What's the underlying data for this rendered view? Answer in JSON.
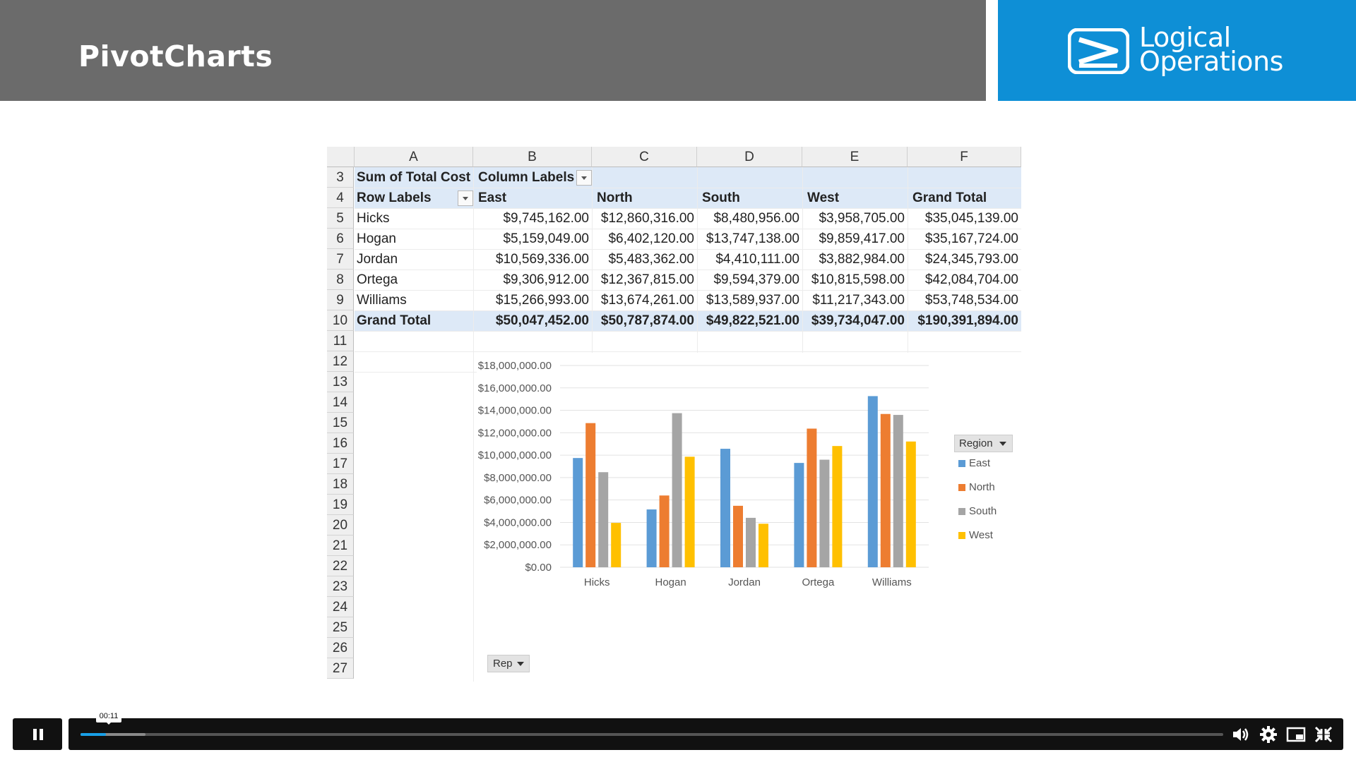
{
  "slide": {
    "title": "PivotCharts"
  },
  "logo": {
    "line1": "Logical",
    "line2": "Operations",
    "colors": {
      "background": "#0e8fd6",
      "title_bar": "#6b6b6b"
    }
  },
  "sheet": {
    "columns": [
      "A",
      "B",
      "C",
      "D",
      "E",
      "F"
    ],
    "row_numbers": [
      "3",
      "4",
      "5",
      "6",
      "7",
      "8",
      "9",
      "10",
      "11",
      "12",
      "13",
      "14",
      "15",
      "16",
      "17",
      "18",
      "19",
      "20",
      "21",
      "22",
      "23",
      "24",
      "25",
      "26",
      "27"
    ],
    "r3": {
      "a": "Sum of Total Cost",
      "b": "Column Labels"
    },
    "r4": {
      "a": "Row Labels",
      "b": "East",
      "c": "North",
      "d": "South",
      "e": "West",
      "f": "Grand Total"
    },
    "rows": [
      {
        "rep": "Hicks",
        "east": "$9,745,162.00",
        "north": "$12,860,316.00",
        "south": "$8,480,956.00",
        "west": "$3,958,705.00",
        "total": "$35,045,139.00"
      },
      {
        "rep": "Hogan",
        "east": "$5,159,049.00",
        "north": "$6,402,120.00",
        "south": "$13,747,138.00",
        "west": "$9,859,417.00",
        "total": "$35,167,724.00"
      },
      {
        "rep": "Jordan",
        "east": "$10,569,336.00",
        "north": "$5,483,362.00",
        "south": "$4,410,111.00",
        "west": "$3,882,984.00",
        "total": "$24,345,793.00"
      },
      {
        "rep": "Ortega",
        "east": "$9,306,912.00",
        "north": "$12,367,815.00",
        "south": "$9,594,379.00",
        "west": "$10,815,598.00",
        "total": "$42,084,704.00"
      },
      {
        "rep": "Williams",
        "east": "$15,266,993.00",
        "north": "$13,674,261.00",
        "south": "$13,589,937.00",
        "west": "$11,217,343.00",
        "total": "$53,748,534.00"
      }
    ],
    "grand_total": {
      "label": "Grand Total",
      "east": "$50,047,452.00",
      "north": "$50,787,874.00",
      "south": "$49,822,521.00",
      "west": "$39,734,047.00",
      "total": "$190,391,894.00"
    }
  },
  "chart_data": {
    "type": "bar",
    "categories": [
      "Hicks",
      "Hogan",
      "Jordan",
      "Ortega",
      "Williams"
    ],
    "series": [
      {
        "name": "East",
        "color": "#5b9bd5",
        "values": [
          9745162,
          5159049,
          10569336,
          9306912,
          15266993
        ]
      },
      {
        "name": "North",
        "color": "#ed7d31",
        "values": [
          12860316,
          6402120,
          5483362,
          12367815,
          13674261
        ]
      },
      {
        "name": "South",
        "color": "#a5a5a5",
        "values": [
          8480956,
          13747138,
          4410111,
          9594379,
          13589937
        ]
      },
      {
        "name": "West",
        "color": "#ffc000",
        "values": [
          3958705,
          9859417,
          3882984,
          10815598,
          11217343
        ]
      }
    ],
    "y_ticks": [
      "$0.00",
      "$2,000,000.00",
      "$4,000,000.00",
      "$6,000,000.00",
      "$8,000,000.00",
      "$10,000,000.00",
      "$12,000,000.00",
      "$14,000,000.00",
      "$16,000,000.00",
      "$18,000,000.00"
    ],
    "ylim": [
      0,
      18000000
    ],
    "grid": true,
    "legend_title": "Region",
    "legend_position": "right",
    "axis_field_button": "Rep"
  },
  "player": {
    "timestamp": "00:11",
    "progress_fraction": 0.022,
    "buffered_fraction": 0.057
  }
}
